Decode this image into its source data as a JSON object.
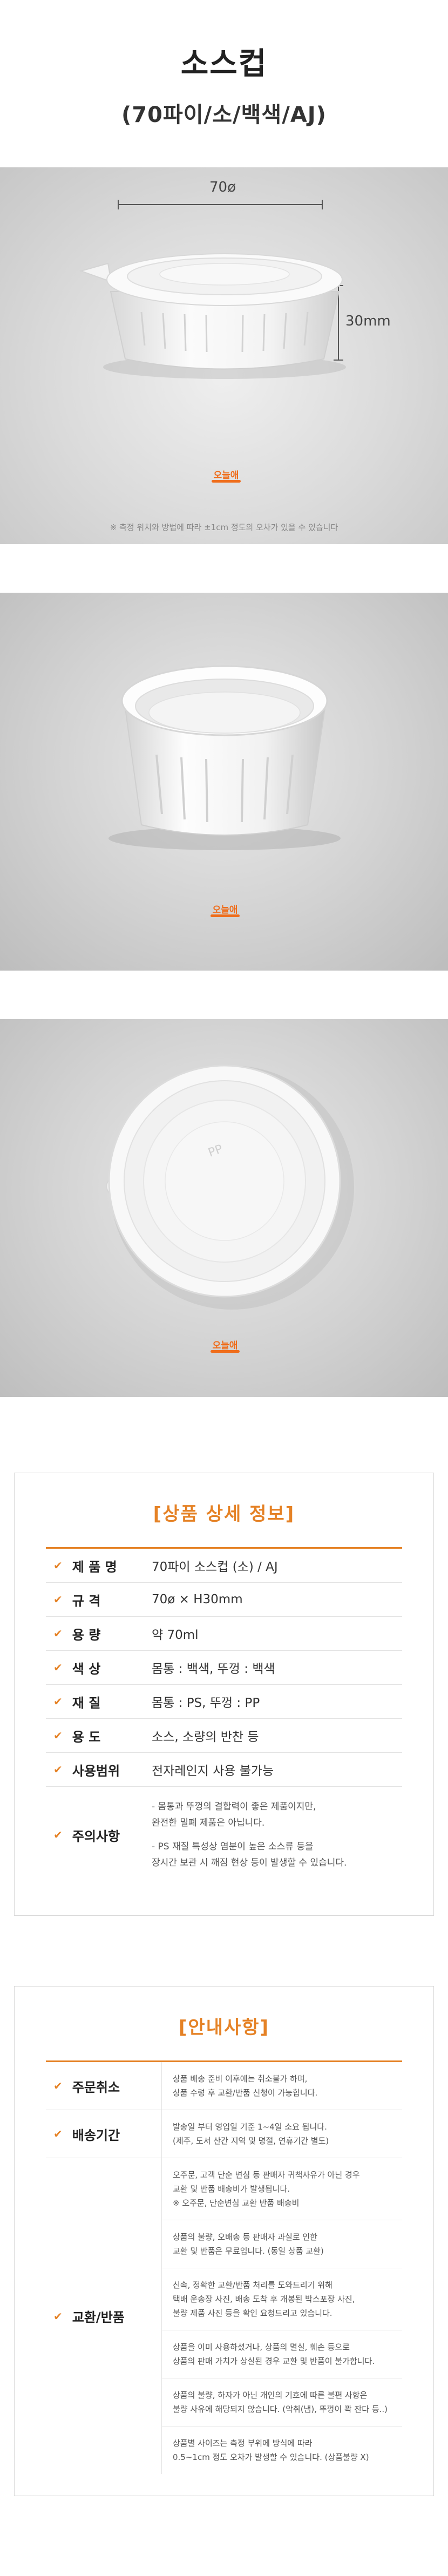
{
  "header": {
    "title": "소스컵",
    "subtitle": "(70파이/소/백색/AJ)"
  },
  "photo1": {
    "width_label": "70ø",
    "height_label": "30mm",
    "brand": "오늘애",
    "note": "※ 측정 위치와 방법에 따라 ±1cm 정도의 오차가 있을 수 있습니다"
  },
  "photo2": {
    "brand": "오늘애"
  },
  "photo3": {
    "brand": "오늘애",
    "lid_emboss": "PP"
  },
  "spec": {
    "title": "[상품 상세 정보]",
    "rows": [
      {
        "label": "제 품 명",
        "value": "70파이 소스컵 (소) / AJ"
      },
      {
        "label": "규    격",
        "value": "70ø × H30mm"
      },
      {
        "label": "용    량",
        "value": "약 70ml"
      },
      {
        "label": "색    상",
        "value": "몸통 : 백색, 뚜껑 : 백색"
      },
      {
        "label": "재    질",
        "value": "몸통 : PS, 뚜껑 : PP"
      },
      {
        "label": "용    도",
        "value": "소스, 소량의 반찬 등"
      },
      {
        "label": "사용범위",
        "value": "전자레인지 사용 불가능"
      },
      {
        "label": "주의사항",
        "notes": [
          "- 몸통과 뚜껑의 결합력이 좋은 제품이지만,",
          "  완전한 밀폐 제품은 아닙니다.",
          "- PS 재질 특성상 염분이 높은 소스류 등을",
          "  장시간 보관 시 깨짐 현상 등이 발생할 수 있습니다."
        ]
      }
    ]
  },
  "guide": {
    "title": "[안내사항]",
    "sections": [
      {
        "label": "주문취소",
        "blocks": [
          [
            "상품 배송 준비 이후에는 취소불가 하며,",
            "상품 수령 후 교환/반품 신청이 가능합니다."
          ]
        ]
      },
      {
        "label": "배송기간",
        "blocks": [
          [
            "발송일 부터 영업일 기준 1~4일 소요 됩니다.",
            "(제주, 도서 산간 지역 및 명절, 연휴기간 별도)"
          ]
        ]
      },
      {
        "label": "교환/반품",
        "blocks": [
          [
            "오주문, 고객 단순 변심 등 판매자 귀책사유가 아닌 경우",
            "교환 및 반품 배송비가 발생됩니다.",
            "※ 오주문, 단순변심 교환 반품 배송비"
          ],
          [
            "상품의 불량, 오배송 등 판매자 과실로 인한",
            "교환 및 반품은 무료입니다. (동일 상품 교환)"
          ],
          [
            "신속, 정확한 교환/반품 처리를 도와드리기 위해",
            "택배 운송장 사진, 배송 도착 후 개봉된 박스포장 사진,",
            "불량 제품 사진 등을 확인 요청드리고 있습니다."
          ],
          [
            "상품을 이미 사용하셨거나, 상품의 멸실, 훼손 등으로",
            "상품의 판매 가치가 상실된 경우 교환 및 반품이 불가합니다."
          ],
          [
            "상품의 불량, 하자가 아닌 개인의 기호에 따른 불편 사항은",
            "불량 사유에 해당되지 않습니다. (악취(냄), 뚜껑이 꽉 잔다 등..)"
          ],
          [
            "상품별 사이즈는 측정 부위에 방식에 따라",
            "0.5~1cm 정도 오차가 발생할 수 있습니다. (상품불량 X)"
          ]
        ]
      }
    ]
  },
  "colors": {
    "accent": "#e58226",
    "brand": "#ef6d1b"
  }
}
